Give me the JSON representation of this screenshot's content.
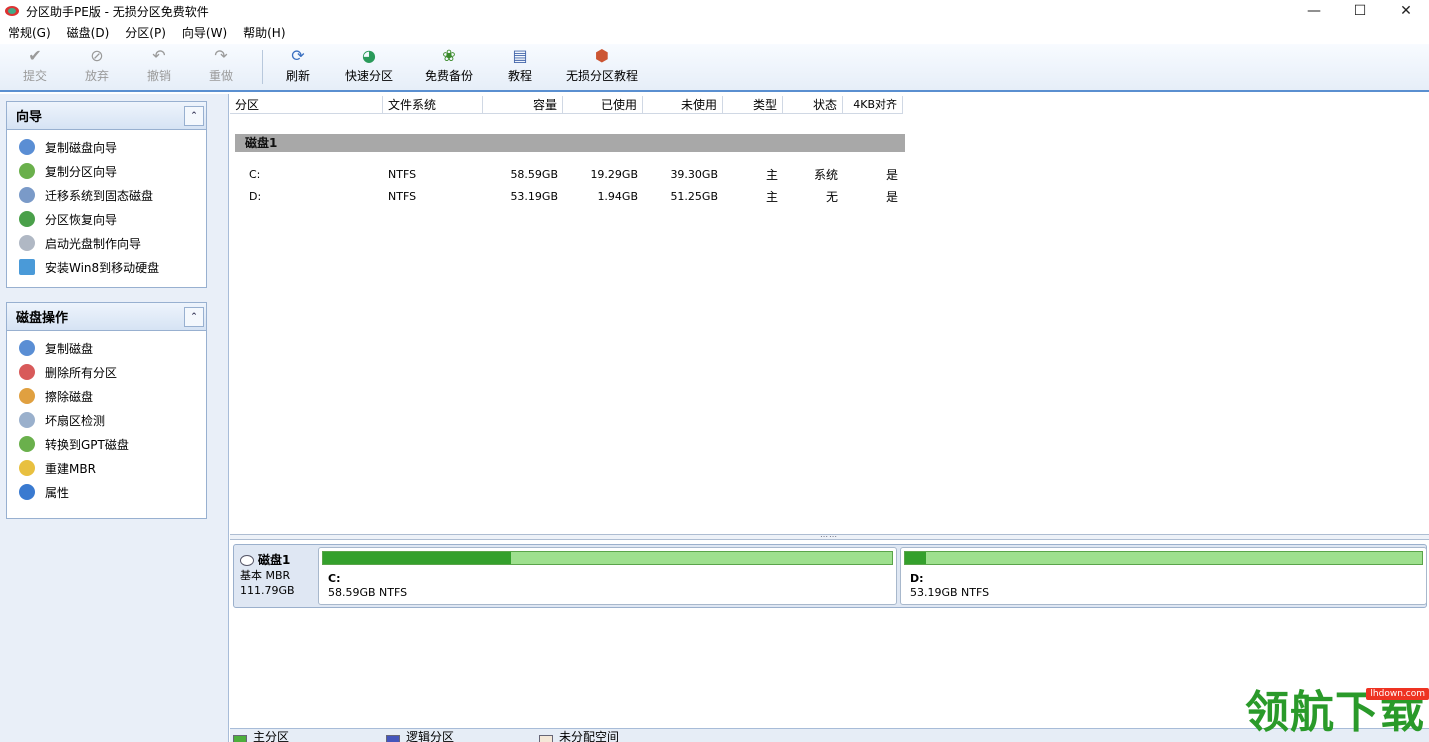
{
  "window": {
    "title": "分区助手PE版 - 无损分区免费软件",
    "controls": {
      "minimize": "—",
      "maximize": "☐",
      "close": "✕"
    }
  },
  "menu": [
    {
      "label": "常规(G)"
    },
    {
      "label": "磁盘(D)"
    },
    {
      "label": "分区(P)"
    },
    {
      "label": "向导(W)"
    },
    {
      "label": "帮助(H)"
    }
  ],
  "toolbar": {
    "commit": {
      "label": "提交",
      "icon": "check-icon"
    },
    "discard": {
      "label": "放弃",
      "icon": "discard-icon"
    },
    "undo": {
      "label": "撤销",
      "icon": "undo-icon"
    },
    "redo": {
      "label": "重做",
      "icon": "redo-icon"
    },
    "refresh": {
      "label": "刷新",
      "icon": "refresh-icon"
    },
    "quick_partition": {
      "label": "快速分区",
      "icon": "quick-partition-icon"
    },
    "free_backup": {
      "label": "免费备份",
      "icon": "backup-icon"
    },
    "tutorial": {
      "label": "教程",
      "icon": "book-icon"
    },
    "lossless_tutorial": {
      "label": "无损分区教程",
      "icon": "lossless-tutorial-icon"
    }
  },
  "wizard_panel": {
    "title": "向导",
    "items": [
      {
        "label": "复制磁盘向导"
      },
      {
        "label": "复制分区向导"
      },
      {
        "label": "迁移系统到固态磁盘"
      },
      {
        "label": "分区恢复向导"
      },
      {
        "label": "启动光盘制作向导"
      },
      {
        "label": "安装Win8到移动硬盘"
      }
    ]
  },
  "disk_ops_panel": {
    "title": "磁盘操作",
    "items": [
      {
        "label": "复制磁盘"
      },
      {
        "label": "删除所有分区"
      },
      {
        "label": "擦除磁盘"
      },
      {
        "label": "坏扇区检测"
      },
      {
        "label": "转换到GPT磁盘"
      },
      {
        "label": "重建MBR"
      },
      {
        "label": "属性"
      }
    ]
  },
  "table": {
    "headers": [
      "分区",
      "文件系统",
      "容量",
      "已使用",
      "未使用",
      "类型",
      "状态",
      "4KB对齐"
    ],
    "group_label": "磁盘1",
    "rows": [
      {
        "partition": "C:",
        "fs": "NTFS",
        "capacity": "58.59GB",
        "used": "19.29GB",
        "free": "39.30GB",
        "type": "主",
        "status": "系统",
        "aligned": "是"
      },
      {
        "partition": "D:",
        "fs": "NTFS",
        "capacity": "53.19GB",
        "used": "1.94GB",
        "free": "51.25GB",
        "type": "主",
        "status": "无",
        "aligned": "是"
      }
    ]
  },
  "disk_map": {
    "disk_name": "磁盘1",
    "disk_type": "基本 MBR",
    "disk_size": "111.79GB",
    "partitions": [
      {
        "name": "C:",
        "detail": "58.59GB NTFS",
        "used_fraction": 0.33
      },
      {
        "name": "D:",
        "detail": "53.19GB NTFS",
        "used_fraction": 0.04
      }
    ]
  },
  "legend": [
    {
      "label": "主分区",
      "color": "#4cae3c"
    },
    {
      "label": "逻辑分区",
      "color": "#4455bb"
    },
    {
      "label": "未分配空间",
      "color": "#f4e8d8"
    }
  ],
  "watermark": {
    "text": "领航下载",
    "url": "lhdown.com"
  },
  "colors": {
    "accent": "#5a8fd0",
    "used_green": "#34a02c",
    "free_green": "#9ee08e"
  }
}
